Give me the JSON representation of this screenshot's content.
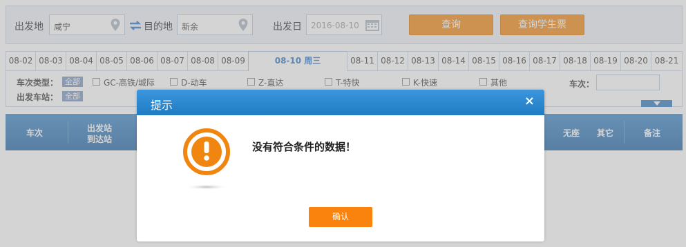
{
  "search": {
    "from_label": "出发地",
    "from_value": "咸宁",
    "to_label": "目的地",
    "to_value": "新余",
    "date_label": "出发日",
    "date_value": "2016-08-10",
    "query_button": "查询",
    "student_button": "查询学生票"
  },
  "date_tabs": [
    "08-02",
    "08-03",
    "08-04",
    "08-05",
    "08-06",
    "08-07",
    "08-08",
    "08-09",
    "08-10 周三",
    "08-11",
    "08-12",
    "08-13",
    "08-14",
    "08-15",
    "08-16",
    "08-17",
    "08-18",
    "08-19",
    "08-20",
    "08-21"
  ],
  "filter": {
    "type_label": "车次类型：",
    "all": "全部",
    "types": [
      "GC-高铁/城际",
      "D-动车",
      "Z-直达",
      "T-特快",
      "K-快速",
      "其他"
    ],
    "train_no_label": "车次：",
    "station_label": "出发车站：",
    "station_all": "全部"
  },
  "table": {
    "col_train": "车次",
    "col_depart": "出发站",
    "col_arrive": "到达站",
    "col_noseat": "无座",
    "col_other": "其它",
    "col_remark": "备注"
  },
  "dialog": {
    "title": "提示",
    "close": "×",
    "message": "没有符合条件的数据！",
    "confirm": "确认"
  },
  "colors": {
    "accent_orange": "#f2860f",
    "header_blue": "#1f7bc3"
  }
}
